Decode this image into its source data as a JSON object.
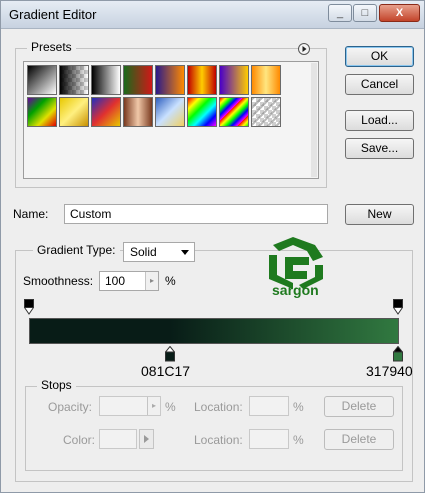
{
  "window": {
    "title": "Gradient Editor",
    "controls": {
      "minimize": "_",
      "maximize": "□",
      "close": "X"
    }
  },
  "presets": {
    "label": "Presets",
    "menu_icon": "play-circle-icon",
    "swatches": [
      {
        "css": "linear-gradient(135deg,#000,#fff)"
      },
      {
        "css": "checker-black"
      },
      {
        "css": "linear-gradient(90deg,#000,#fff)"
      },
      {
        "css": "linear-gradient(90deg,#1a6a1a,#d01818)"
      },
      {
        "css": "linear-gradient(90deg,#2a1a8a,#ff8a00)"
      },
      {
        "css": "linear-gradient(90deg,#c00000,#ffcc00,#c00000)"
      },
      {
        "css": "linear-gradient(90deg,#4a00c8,#ffcc00)"
      },
      {
        "css": "linear-gradient(90deg,#ff8a00,#ffe680,#ff8a00)"
      },
      {
        "css": "linear-gradient(135deg,#6a00a0,#00a000,#e0e000,#e00000)"
      },
      {
        "css": "linear-gradient(135deg,#e8c800,#fff080,#c89000)"
      },
      {
        "css": "linear-gradient(135deg,#2030c0,#e03030,#e8c800)"
      },
      {
        "css": "linear-gradient(90deg,#7a3a20,#f0c8a8,#7a3a20)"
      },
      {
        "css": "linear-gradient(135deg,#3060c0,#c8e0ff,#f0d060)"
      },
      {
        "css": "linear-gradient(135deg,#ff0000,#ffff00,#00ff00,#00ffff,#0000ff,#ff00ff)"
      },
      {
        "css": "repeating-linear-gradient(135deg,#ff0000 0px,#ffff00 4px,#00ff00 8px,#0000ff 12px,#ff00ff 16px)"
      },
      {
        "css": "checker-stripe"
      }
    ]
  },
  "buttons": {
    "ok": "OK",
    "cancel": "Cancel",
    "load": "Load...",
    "save": "Save...",
    "new": "New",
    "delete_opacity": "Delete",
    "delete_color": "Delete"
  },
  "name_field": {
    "label": "Name:",
    "value": "Custom"
  },
  "gradient_type": {
    "label": "Gradient Type:",
    "value": "Solid"
  },
  "smoothness": {
    "label": "Smoothness:",
    "value": "100",
    "unit": "%"
  },
  "logo": {
    "text": "sargon",
    "color": "#1f7a1f"
  },
  "gradient": {
    "color_start": "#081C17",
    "color_end": "#317940",
    "stop_left_label": "081C17",
    "stop_right_label": "317940"
  },
  "stops": {
    "label": "Stops",
    "opacity_label": "Opacity:",
    "opacity_unit": "%",
    "location_label_1": "Location:",
    "location_unit_1": "%",
    "color_label": "Color:",
    "location_label_2": "Location:",
    "location_unit_2": "%"
  }
}
